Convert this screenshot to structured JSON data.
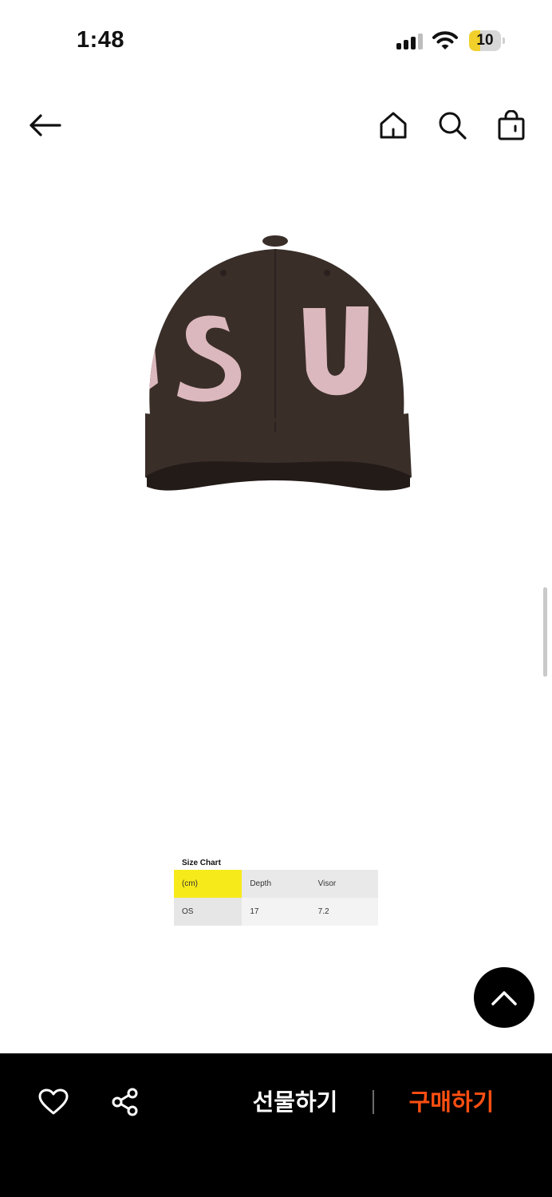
{
  "status_bar": {
    "time": "1:48",
    "battery_level": "10",
    "icons": [
      "cellular-signal-icon",
      "wifi-icon",
      "battery-icon"
    ]
  },
  "nav": {
    "icons": [
      "back-arrow-icon",
      "home-icon",
      "search-icon",
      "shopping-bag-icon"
    ]
  },
  "product": {
    "image_icon": "baseball-cap-image",
    "cap_color": "#3a2e29",
    "lettering_color": "#dbb8bd",
    "lettering": "SU"
  },
  "size_chart": {
    "title": "Size Chart",
    "headers": [
      "(cm)",
      "Depth",
      "Visor"
    ],
    "rows": [
      [
        "OS",
        "17",
        "7.2"
      ]
    ],
    "highlight_color": "#f7ea1a"
  },
  "scroll_top": {
    "icon": "chevron-up-icon"
  },
  "bottom_bar": {
    "like_icon": "heart-icon",
    "share_icon": "share-icon",
    "gift_label": "선물하기",
    "buy_label": "구매하기",
    "buy_color": "#ff4f12"
  }
}
